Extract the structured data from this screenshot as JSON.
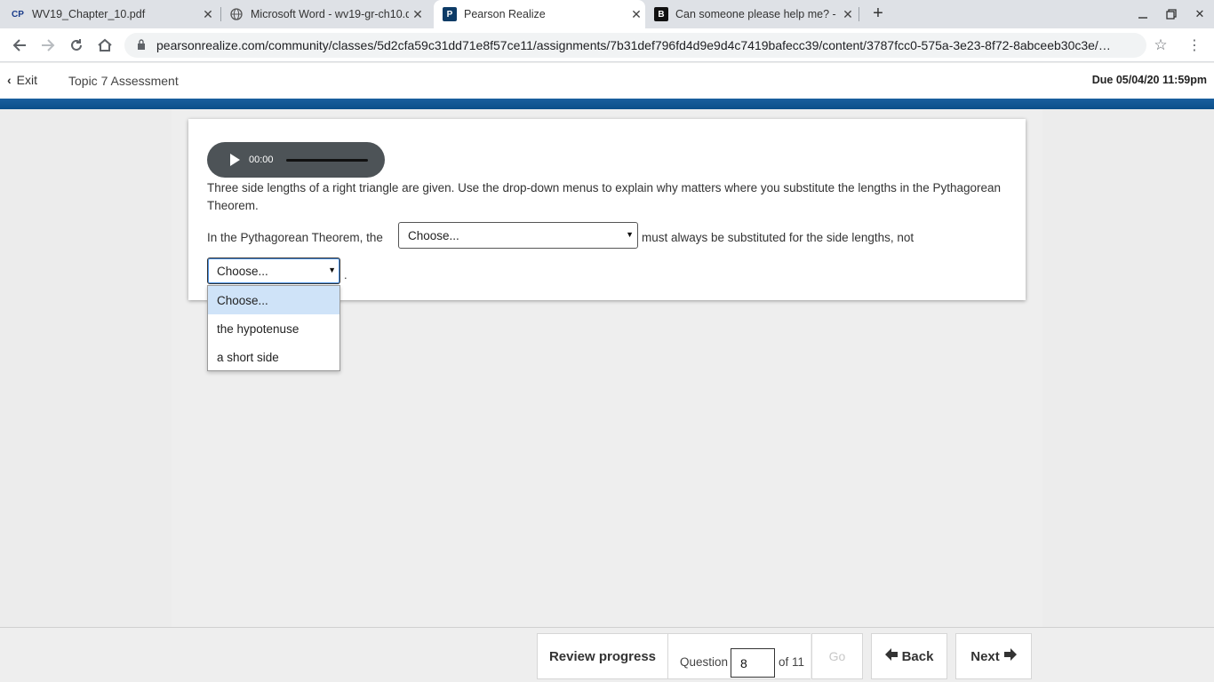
{
  "browser": {
    "tabs": [
      {
        "title": "WV19_Chapter_10.pdf",
        "favicon": "CP"
      },
      {
        "title": "Microsoft Word - wv19-gr-ch10.d",
        "favicon": "globe-icon"
      },
      {
        "title": "Pearson Realize",
        "favicon": "P"
      },
      {
        "title": "Can someone please help me? -",
        "favicon": "B"
      }
    ],
    "url": "pearsonrealize.com/community/classes/5d2cfa59c31dd71e8f57ce11/assignments/7b31def796fd4d9e9d4c7419bafecc39/content/3787fcc0-575a-3e23-8f72-8abceeb30c3e/…"
  },
  "header": {
    "exit_label": "Exit",
    "topic": "Topic 7 Assessment",
    "due": "Due 05/04/20 11:59pm"
  },
  "question": {
    "audio_time": "00:00",
    "prompt": "Three side lengths of a right triangle are given. Use the drop-down menus to explain why matters where you substitute the lengths in the Pythagorean Theorem.",
    "sentence_part1": "In the Pythagorean Theorem, the",
    "sentence_part2": "must always be substituted for the side lengths, not",
    "select1_value": "Choose...",
    "select2_value": "Choose...",
    "period": ".",
    "dropdown_options": [
      "Choose...",
      "the hypotenuse",
      "a short side"
    ]
  },
  "footer": {
    "review_label": "Review progress",
    "question_label": "Question",
    "question_number": "8",
    "of_label": "of 11",
    "go_label": "Go",
    "back_label": "Back",
    "next_label": "Next"
  }
}
